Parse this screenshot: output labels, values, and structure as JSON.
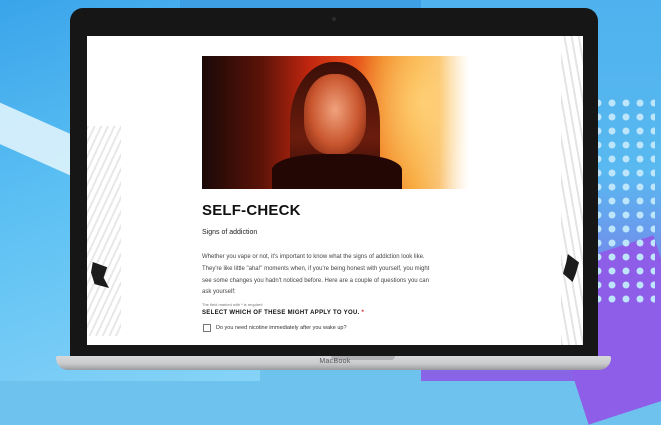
{
  "device": {
    "brand_label": "MacBook"
  },
  "page": {
    "title": "SELF-CHECK",
    "subtitle": "Signs of addiction",
    "intro_lines": [
      "Whether you vape or not, it's important to know what the signs of addiction look like.",
      "They're like little \"aha!\" moments when, if you're being honest with yourself, you might",
      "see some changes you hadn't noticed before. Here are a couple of questions you can",
      "ask yourself:"
    ],
    "required_note": "The field marked with * is required",
    "question": {
      "label": "SELECT WHICH OF THESE MIGHT APPLY TO YOU.",
      "required_marker": "*"
    },
    "options": [
      {
        "label": "Do you need nicotine immediately after you wake up?",
        "checked": false
      }
    ]
  },
  "colors": {
    "accent_required": "#d2232a",
    "hero_red": "#c0260f",
    "hero_orange": "#f0801f",
    "background_blue": "#6ec3ee",
    "background_purple": "#8f5ee8"
  }
}
